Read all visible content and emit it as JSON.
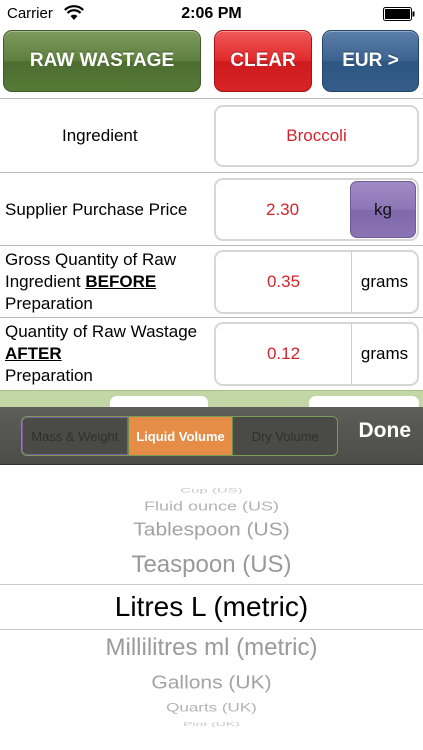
{
  "status_bar": {
    "carrier": "Carrier",
    "time": "2:06 PM"
  },
  "header": {
    "raw_wastage_label": "RAW WASTAGE",
    "clear_label": "CLEAR",
    "currency_label": "EUR >"
  },
  "form": {
    "ingredient": {
      "label": "Ingredient",
      "value": "Broccoli"
    },
    "price": {
      "label": "Supplier Purchase Price",
      "value": "2.30",
      "unit": "kg"
    },
    "gross": {
      "label_pre": "Gross Quantity of Raw Ingredient ",
      "label_emph": "BEFORE",
      "label_post": "Preparation",
      "value": "0.35",
      "unit": "grams"
    },
    "wastage": {
      "label_pre": "Quantity of Raw Wastage ",
      "label_emph": "AFTER",
      "label_post": "Preparation",
      "value": "0.12",
      "unit": "grams"
    }
  },
  "picker_toolbar": {
    "segments": [
      "Mass & Weight",
      "Liquid Volume",
      "Dry Volume"
    ],
    "active_segment": "Liquid Volume",
    "done_label": "Done"
  },
  "picker": {
    "items": [
      "Cup (US)",
      "Fluid ounce (US)",
      "Tablespoon (US)",
      "Teaspoon (US)",
      "Litres L (metric)",
      "Millilitres ml (metric)",
      "Gallons (UK)",
      "Quarts (UK)",
      "Pint (UK)"
    ],
    "selected": "Litres L (metric)"
  },
  "colors": {
    "accent_green": "#5f7f3f",
    "accent_red": "#e1282b",
    "accent_blue": "#3c6390",
    "value_red": "#d6232a",
    "unit_purple": "#8c76b6",
    "segment_orange": "#e58c46"
  }
}
